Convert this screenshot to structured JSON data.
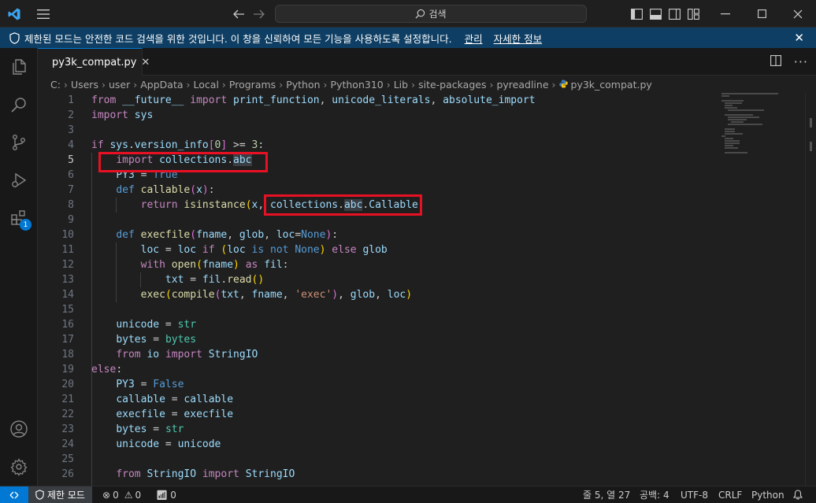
{
  "titlebar": {
    "search_label": "검색"
  },
  "banner": {
    "message": "제한된 모드는 안전한 코드 검색을 위한 것입니다. 이 창을 신뢰하여 모든 기능을 사용하도록 설정합니다.",
    "manage_link": "관리",
    "details_link": "자세한 정보"
  },
  "activity": {
    "extensions_badge": "1"
  },
  "tab": {
    "filename": "py3k_compat.py"
  },
  "breadcrumb": [
    "C:",
    "Users",
    "user",
    "AppData",
    "Local",
    "Programs",
    "Python",
    "Python310",
    "Lib",
    "site-packages",
    "pyreadline",
    "py3k_compat.py"
  ],
  "editor": {
    "line_numbers": [
      "1",
      "2",
      "3",
      "4",
      "5",
      "6",
      "7",
      "8",
      "9",
      "10",
      "11",
      "12",
      "13",
      "14",
      "15",
      "16",
      "17",
      "18",
      "19",
      "20",
      "21",
      "22",
      "23",
      "24",
      "25",
      "26"
    ],
    "active_line": "5",
    "lines": [
      "from __future__ import print_function, unicode_literals, absolute_import",
      "import sys",
      "",
      "if sys.version_info[0] >= 3:",
      "    import collections.abc",
      "    PY3 = True",
      "    def callable(x):",
      "        return isinstance(x, collections.abc.Callable)",
      "",
      "    def execfile(fname, glob, loc=None):",
      "        loc = loc if (loc is not None) else glob",
      "        with open(fname) as fil:",
      "            txt = fil.read()",
      "        exec(compile(txt, fname, 'exec'), glob, loc)",
      "",
      "    unicode = str",
      "    bytes = bytes",
      "    from io import StringIO",
      "else:",
      "    PY3 = False",
      "    callable = callable",
      "    execfile = execfile",
      "    bytes = str",
      "    unicode = unicode",
      "",
      "    from StringIO import StringIO"
    ]
  },
  "statusbar": {
    "mode": "제한 모드",
    "errors": "0",
    "warnings": "0",
    "ports": "0",
    "position": "줄 5, 열 27",
    "spaces": "공백: 4",
    "encoding": "UTF-8",
    "eol": "CRLF",
    "language": "Python"
  },
  "colors": {
    "accent": "#0078d4",
    "banner_bg": "#0e3e63",
    "highlight_box": "#e81123"
  }
}
